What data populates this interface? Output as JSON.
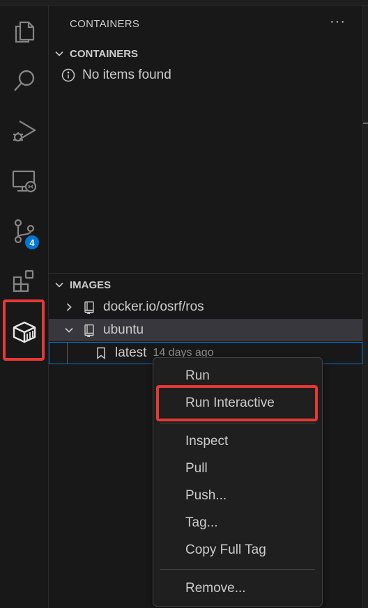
{
  "activity_bar": {
    "items": [
      {
        "name": "explorer",
        "icon": "files-icon"
      },
      {
        "name": "search",
        "icon": "search-icon"
      },
      {
        "name": "run-debug",
        "icon": "run-debug-icon"
      },
      {
        "name": "remote-explorer",
        "icon": "remote-explorer-icon"
      },
      {
        "name": "source-control",
        "icon": "source-control-icon",
        "badge": "4"
      },
      {
        "name": "extensions",
        "icon": "extensions-icon"
      },
      {
        "name": "containers",
        "icon": "container-icon",
        "highlighted": true
      }
    ]
  },
  "sidebar": {
    "title": "CONTAINERS",
    "more_actions": "···",
    "containers_section": {
      "label": "CONTAINERS",
      "empty_message": "No items found"
    },
    "images_section": {
      "label": "IMAGES",
      "items": [
        {
          "label": "docker.io/osrf/ros",
          "expanded": false
        },
        {
          "label": "ubuntu",
          "expanded": true,
          "children": [
            {
              "label": "latest",
              "description": "14 days ago"
            }
          ]
        }
      ]
    }
  },
  "context_menu": {
    "groups": [
      [
        "Run",
        "Run Interactive"
      ],
      [
        "Inspect",
        "Pull",
        "Push...",
        "Tag...",
        "Copy Full Tag"
      ],
      [
        "Remove..."
      ]
    ],
    "highlighted_item": "Run Interactive"
  },
  "colors": {
    "background": "#181818",
    "accent_badge": "#0078d4",
    "highlight_box": "#e53935",
    "menu_background": "#1f1f1f",
    "selected_row": "#37373d"
  }
}
